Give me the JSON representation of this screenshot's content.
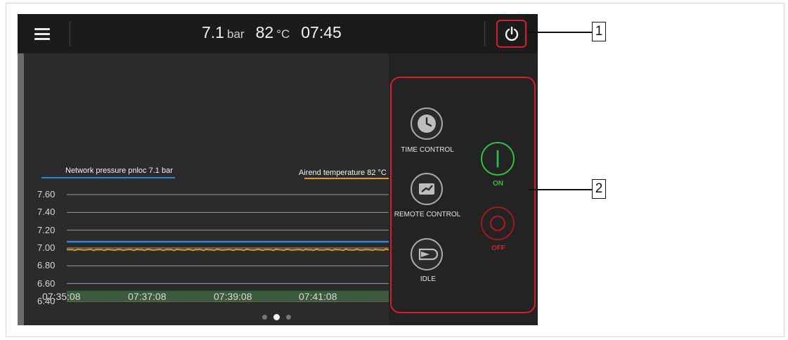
{
  "header": {
    "pressure_value": "7.1",
    "pressure_unit": "bar",
    "temperature_value": "82",
    "temperature_unit": "°C",
    "time": "07:45"
  },
  "chart_data": {
    "type": "line",
    "series": [
      {
        "name": "Network pressure pnloc 7.1 bar",
        "color": "#2f86d6",
        "values": [
          7.07,
          7.07,
          7.07,
          7.07,
          7.07,
          7.07
        ]
      },
      {
        "name": "Airend temperature 82 °C",
        "color": "#e39a1a",
        "values": [
          6.98,
          6.98,
          6.98,
          6.98,
          6.98,
          6.98
        ]
      }
    ],
    "x": [
      "07:35:08",
      "07:37:08",
      "07:39:08",
      "07:41:08"
    ],
    "y_ticks": [
      "7.60",
      "7.40",
      "7.20",
      "7.00",
      "6.80",
      "6.60",
      "6.40"
    ],
    "ylim": [
      6.4,
      7.6
    ],
    "grid": true
  },
  "mode_panel": {
    "time_control": "TIME CONTROL",
    "remote_control": "REMOTE CONTROL",
    "idle": "IDLE",
    "on": "ON",
    "off": "OFF"
  },
  "callouts": [
    "1",
    "2"
  ],
  "colors": {
    "highlight": "#d21f2b",
    "on": "#2fbe45",
    "off": "#d0202b"
  }
}
